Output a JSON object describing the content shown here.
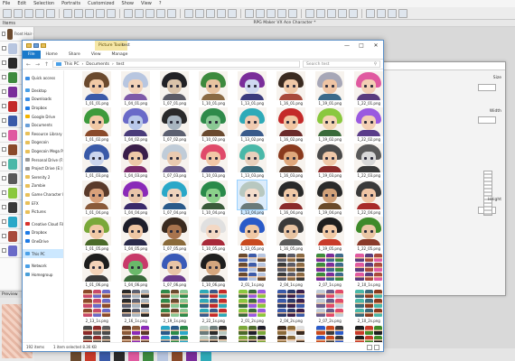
{
  "background_app": {
    "menu": [
      "File",
      "Edit",
      "Selection",
      "Portraits",
      "Customized",
      "Show",
      "View",
      "?"
    ],
    "left_panel_label": "Items",
    "window_title": "RPG Maker VX Ace Character *",
    "layers": [
      "Front Hair (shade)",
      "",
      "",
      "",
      "",
      "",
      "",
      "",
      "",
      "",
      "",
      "",
      "",
      "",
      "",
      ""
    ],
    "preview_label": "Preview",
    "dialog_text": [
      "Size",
      "Width",
      "Height"
    ],
    "colors": {
      "menu_bg": "#f5f5f5",
      "toolbar_bg": "#ececec",
      "canvas_bg": "#d9d9d9"
    }
  },
  "explorer": {
    "context_tab": "Picture Tools",
    "title": "test",
    "ribbon_tabs": [
      "File",
      "Home",
      "Share",
      "View",
      "Manage"
    ],
    "path": [
      "This PC",
      "Documents",
      "test"
    ],
    "search_placeholder": "Search test",
    "nav_items": [
      {
        "label": "Quick access",
        "icon": "star",
        "color": "#3a8ee6"
      },
      {
        "label": "Desktop",
        "icon": "desktop",
        "color": "#4aa0e8"
      },
      {
        "label": "Downloads",
        "icon": "download",
        "color": "#3a8ee6"
      },
      {
        "label": "Dropbox",
        "icon": "dropbox",
        "color": "#1e7be6"
      },
      {
        "label": "Google Drive",
        "icon": "drive",
        "color": "#f4b400"
      },
      {
        "label": "Documents",
        "icon": "doc",
        "color": "#6a9fd8"
      },
      {
        "label": "Resource Library",
        "icon": "folder",
        "color": "#e8c05a"
      },
      {
        "label": "Dogecoin",
        "icon": "folder",
        "color": "#e8c05a"
      },
      {
        "label": "Dogecoin Mega Pack",
        "icon": "folder",
        "color": "#e8c05a"
      },
      {
        "label": "Personal Drive (F:)",
        "icon": "drive",
        "color": "#9a9a9a"
      },
      {
        "label": "Project Drive (E:)",
        "icon": "drive",
        "color": "#9a9a9a"
      },
      {
        "label": "Serenity 2",
        "icon": "folder",
        "color": "#e8c05a"
      },
      {
        "label": "Zombie",
        "icon": "folder",
        "color": "#e8c05a"
      },
      {
        "label": "Game Character Hu",
        "icon": "folder",
        "color": "#e8c05a"
      },
      {
        "label": "EFX",
        "icon": "folder",
        "color": "#e8c05a"
      },
      {
        "label": "Pictures",
        "icon": "pictures",
        "color": "#e8c05a"
      },
      {
        "label": "Creative Cloud Files",
        "icon": "cloud",
        "color": "#d9332b"
      },
      {
        "label": "Dropbox",
        "icon": "dropbox",
        "color": "#1e7be6"
      },
      {
        "label": "OneDrive",
        "icon": "cloud",
        "color": "#1e7be6"
      },
      {
        "label": "This PC",
        "icon": "pc",
        "color": "#4aa0e8"
      },
      {
        "label": "Network",
        "icon": "network",
        "color": "#4aa0e8"
      },
      {
        "label": "Homegroup",
        "icon": "homegroup",
        "color": "#4a9fd8"
      }
    ],
    "status_items_count": "192 items",
    "status_selected": "1 item selected 8.36 KB",
    "files": [
      {
        "label": "1_01_01.png",
        "kind": "face",
        "hair": "#6b4a2e",
        "skin": "#f1c9a5",
        "body": "#3c5aa8"
      },
      {
        "label": "1_04_01.png",
        "kind": "face",
        "hair": "#b8c6e0",
        "skin": "#f3d2b8",
        "body": "#7e5aa8"
      },
      {
        "label": "1_07_01.png",
        "kind": "face",
        "hair": "#222226",
        "skin": "#d9c3aa",
        "body": "#5b5b66"
      },
      {
        "label": "1_10_01.png",
        "kind": "face",
        "hair": "#3d8a3e",
        "skin": "#e8c3a0",
        "body": "#8a6a44"
      },
      {
        "label": "1_13_01.png",
        "kind": "face",
        "hair": "#7a2d9a",
        "skin": "#cfd8f1",
        "body": "#3b3b7e"
      },
      {
        "label": "1_16_01.png",
        "kind": "face",
        "hair": "#3a2a20",
        "skin": "#f0c8a6",
        "body": "#a84a3c"
      },
      {
        "label": "1_19_01.png",
        "kind": "face",
        "hair": "#a7a7b7",
        "skin": "#efc4a4",
        "body": "#3c6a8a"
      },
      {
        "label": "1_22_01.png",
        "kind": "face",
        "hair": "#e05aa0",
        "skin": "#f3cfb4",
        "body": "#5a3c7e"
      },
      {
        "label": "1_01_02.png",
        "kind": "face",
        "hair": "#3e9a3c",
        "skin": "#f1c9a5",
        "body": "#8a4a2a"
      },
      {
        "label": "1_04_02.png",
        "kind": "face",
        "hair": "#6a6ac8",
        "skin": "#b9c8ea",
        "body": "#4a3c7a"
      },
      {
        "label": "1_07_02.png",
        "kind": "face",
        "hair": "#2a2a2a",
        "skin": "#a8b5c0",
        "body": "#5c6070"
      },
      {
        "label": "1_10_02.png",
        "kind": "face",
        "hair": "#2f8a4a",
        "skin": "#8ac894",
        "body": "#6a4a30"
      },
      {
        "label": "1_13_02.png",
        "kind": "face",
        "hair": "#2eaab8",
        "skin": "#f0cab0",
        "body": "#3a5a8a"
      },
      {
        "label": "1_16_02.png",
        "kind": "face",
        "hair": "#c42a2a",
        "skin": "#f1c5a2",
        "body": "#6a2a2a"
      },
      {
        "label": "1_19_02.png",
        "kind": "face",
        "hair": "#8ac83e",
        "skin": "#f3d4b2",
        "body": "#3a6a3a"
      },
      {
        "label": "1_22_02.png",
        "kind": "face",
        "hair": "#9a5ae0",
        "skin": "#f3cfb4",
        "body": "#5a3c8a"
      },
      {
        "label": "1_01_03.png",
        "kind": "face",
        "hair": "#3a5aa8",
        "skin": "#cbd5ee",
        "body": "#2a3a6a"
      },
      {
        "label": "1_04_03.png",
        "kind": "face",
        "hair": "#3a1e4a",
        "skin": "#efcaa8",
        "body": "#7a2a6a"
      },
      {
        "label": "1_07_03.png",
        "kind": "face",
        "hair": "#c0ccd8",
        "skin": "#e9cab0",
        "body": "#6a5a8a"
      },
      {
        "label": "1_10_03.png",
        "kind": "face",
        "hair": "#e04a6a",
        "skin": "#f1c7a6",
        "body": "#4a4a7a"
      },
      {
        "label": "1_13_03.png",
        "kind": "face",
        "hair": "#4ab8a8",
        "skin": "#e8d0bc",
        "body": "#3a6a7a"
      },
      {
        "label": "1_16_03.png",
        "kind": "face",
        "hair": "#8a3a1e",
        "skin": "#e0a87c",
        "body": "#5a3a2a"
      },
      {
        "label": "1_19_03.png",
        "kind": "face",
        "hair": "#4a4a4a",
        "skin": "#f0c8a8",
        "body": "#8a2a2a"
      },
      {
        "label": "1_22_03.png",
        "kind": "face",
        "hair": "#5a5a5a",
        "skin": "#d8d8d8",
        "body": "#3a3a3a"
      },
      {
        "label": "1_01_04.png",
        "kind": "face",
        "hair": "#5a3a2a",
        "skin": "#d8a07a",
        "body": "#8a5a3a"
      },
      {
        "label": "1_04_04.png",
        "kind": "face",
        "hair": "#8a2ab8",
        "skin": "#e8c4a8",
        "body": "#3a2a6a"
      },
      {
        "label": "1_07_04.png",
        "kind": "face",
        "hair": "#2aa8c8",
        "skin": "#efd2bc",
        "body": "#2a5a8a"
      },
      {
        "label": "1_10_04.png",
        "kind": "face",
        "hair": "#2a8a4a",
        "skin": "#8ad08a",
        "body": "#3a5a3a"
      },
      {
        "label": "1_13_04.png",
        "kind": "face",
        "hair": "#b8c8c0",
        "skin": "#f3dccb",
        "body": "#6a7a7a",
        "selected": true
      },
      {
        "label": "1_16_04.png",
        "kind": "face",
        "hair": "#2a2a2a",
        "skin": "#efc8a6",
        "body": "#8a2a2a"
      },
      {
        "label": "1_19_04.png",
        "kind": "face",
        "hair": "#2a2a2a",
        "skin": "#d0a078",
        "body": "#6a4a2a"
      },
      {
        "label": "1_22_04.png",
        "kind": "face",
        "hair": "#3a3a3a",
        "skin": "#efc4a4",
        "body": "#a82a2a"
      },
      {
        "label": "1_01_05.png",
        "kind": "face",
        "hair": "#7aa83a",
        "skin": "#f1c9a5",
        "body": "#4a6a2a"
      },
      {
        "label": "1_04_05.png",
        "kind": "face",
        "hair": "#1e1e2a",
        "skin": "#efc6a4",
        "body": "#2a2a4a"
      },
      {
        "label": "1_07_05.png",
        "kind": "face",
        "hair": "#3a2a1e",
        "skin": "#a8744e",
        "body": "#8a6a3a"
      },
      {
        "label": "1_10_05.png",
        "kind": "face",
        "hair": "#e0e0e0",
        "skin": "#f3d8c4",
        "body": "#a82a3a"
      },
      {
        "label": "1_13_05.png",
        "kind": "face",
        "hair": "#2a5ac8",
        "skin": "#f0c8a4",
        "body": "#c84a1e"
      },
      {
        "label": "1_16_05.png",
        "kind": "face",
        "hair": "#3a3a3a",
        "skin": "#e8c4a2",
        "body": "#5a5a5a"
      },
      {
        "label": "1_19_05.png",
        "kind": "face",
        "hair": "#1e1e1e",
        "skin": "#f1c9a5",
        "body": "#c83a2a"
      },
      {
        "label": "1_22_05.png",
        "kind": "face",
        "hair": "#3e8a2a",
        "skin": "#eac6a4",
        "body": "#8a3a2a"
      },
      {
        "label": "1_01_06.png",
        "kind": "face",
        "hair": "#1e1e1e",
        "skin": "#f3d2b8",
        "body": "#3a3a3a"
      },
      {
        "label": "1_04_06.png",
        "kind": "face",
        "hair": "#c83a6a",
        "skin": "#6ab86a",
        "body": "#3a6a3a"
      },
      {
        "label": "1_07_06.png",
        "kind": "face",
        "hair": "#3a5ab8",
        "skin": "#e8c4a6",
        "body": "#6a3a8a"
      },
      {
        "label": "1_10_06.png",
        "kind": "face",
        "hair": "#1e1e1e",
        "skin": "#d4a67e",
        "body": "#3a3a3a"
      },
      {
        "label": "2_01_1s.png",
        "kind": "sprite",
        "colors": [
          "#6b4a2e",
          "#3c5aa8",
          "#b8c6e0"
        ]
      },
      {
        "label": "2_04_1s.png",
        "kind": "sprite",
        "colors": [
          "#3a3a3a",
          "#5b5b66",
          "#8a6a44"
        ]
      },
      {
        "label": "2_07_1s.png",
        "kind": "sprite",
        "colors": [
          "#3d8a3e",
          "#7a2d9a",
          "#3c6a8a"
        ]
      },
      {
        "label": "2_10_1s.png",
        "kind": "sprite",
        "colors": [
          "#e05aa0",
          "#5a3c7e",
          "#a84a3c"
        ]
      },
      {
        "label": "2_13_1s.png",
        "kind": "sprite",
        "colors": [
          "#8a4a2a",
          "#c84a6a",
          "#6a6ac8"
        ]
      },
      {
        "label": "2_16_1s.png",
        "kind": "sprite",
        "colors": [
          "#2a2a2a",
          "#5c6070",
          "#a8b5c0"
        ]
      },
      {
        "label": "2_19_1s.png",
        "kind": "sprite",
        "colors": [
          "#2f8a4a",
          "#6a4a30",
          "#8ac894"
        ]
      },
      {
        "label": "2_22_1s.png",
        "kind": "sprite",
        "colors": [
          "#2eaab8",
          "#3a5a8a",
          "#c42a2a"
        ]
      },
      {
        "label": "2_01_2s.png",
        "kind": "sprite",
        "colors": [
          "#8ac83e",
          "#3a6a3a",
          "#9a5ae0"
        ]
      },
      {
        "label": "2_04_2s.png",
        "kind": "sprite",
        "colors": [
          "#3a5aa8",
          "#2a3a6a",
          "#3a1e4a"
        ]
      },
      {
        "label": "2_07_2s.png",
        "kind": "sprite",
        "colors": [
          "#c0ccd8",
          "#6a5a8a",
          "#e04a6a"
        ]
      },
      {
        "label": "2_10_2s.png",
        "kind": "sprite",
        "colors": [
          "#4ab8a8",
          "#3a6a7a",
          "#8a3a1e"
        ]
      },
      {
        "label": "2_13_2s.png",
        "kind": "sprite",
        "colors": [
          "#4a4a4a",
          "#8a2a2a",
          "#5a5a5a"
        ]
      },
      {
        "label": "2_16_2s.png",
        "kind": "sprite",
        "colors": [
          "#5a3a2a",
          "#8a5a3a",
          "#8a2ab8"
        ]
      },
      {
        "label": "2_19_2s.png",
        "kind": "sprite",
        "colors": [
          "#2aa8c8",
          "#2a5a8a",
          "#2a8a4a"
        ]
      },
      {
        "label": "2_22_2s.png",
        "kind": "sprite",
        "colors": [
          "#b8c8c0",
          "#6a7a7a",
          "#2a2a2a"
        ]
      },
      {
        "label": "2_01_3s.png",
        "kind": "sprite",
        "colors": [
          "#7aa83a",
          "#4a6a2a",
          "#1e1e2a"
        ]
      },
      {
        "label": "2_04_3s.png",
        "kind": "sprite",
        "colors": [
          "#3a2a1e",
          "#8a6a3a",
          "#e0e0e0"
        ]
      },
      {
        "label": "2_07_3s.png",
        "kind": "sprite",
        "colors": [
          "#2a5ac8",
          "#c84a1e",
          "#3a3a3a"
        ]
      },
      {
        "label": "2_10_3s.png",
        "kind": "sprite",
        "colors": [
          "#1e1e1e",
          "#c83a2a",
          "#3e8a2a"
        ]
      }
    ]
  }
}
